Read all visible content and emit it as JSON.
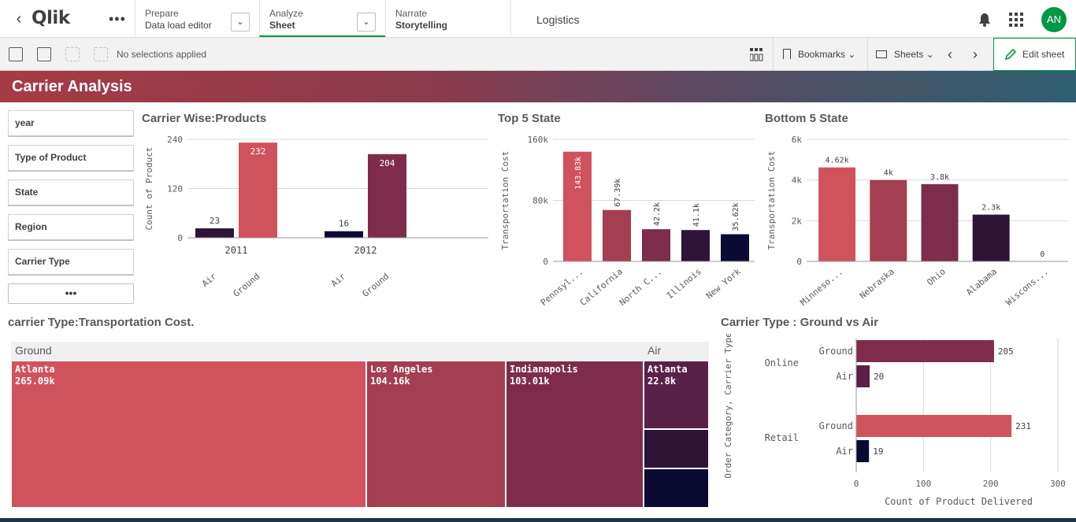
{
  "nav": {
    "prepare": {
      "sub": "Prepare",
      "main": "Data load editor"
    },
    "analyze": {
      "sub": "Analyze",
      "main": "Sheet"
    },
    "narrate": {
      "sub": "Narrate",
      "main": "Storytelling"
    },
    "app_title": "Logistics",
    "avatar": "AN",
    "logo": "Qlik"
  },
  "toolbar": {
    "no_selections": "No selections applied",
    "bookmarks": "Bookmarks",
    "sheets": "Sheets",
    "edit_sheet": "Edit sheet"
  },
  "sheet_title": "Carrier Analysis",
  "filters": [
    "year",
    "Type of Product",
    "State",
    "Region",
    "Carrier Type"
  ],
  "filter_more": "•••",
  "colors": {
    "c1": "#d0525d",
    "c2": "#a43e52",
    "c3": "#7d2c4c",
    "c4": "#5a2148",
    "c5": "#2e1437",
    "c6": "#0a0a33",
    "accent": "#009845"
  },
  "panels": {
    "carrier_products": "Carrier Wise:Products",
    "top5": "Top 5 State",
    "bottom5": "Bottom 5 State",
    "treemap": "carrier Type:Transportation Cost.",
    "ground_vs_air": "Carrier Type : Ground vs Air"
  },
  "chart_data": [
    {
      "type": "bar",
      "title": "Carrier Wise:Products",
      "ylabel": "Count of Product",
      "ylim": [
        0,
        240
      ],
      "yticks": [
        "0",
        "120",
        "240"
      ],
      "categories": [
        "2011",
        "2012"
      ],
      "series": [
        {
          "name": "Air",
          "values": [
            23,
            16
          ]
        },
        {
          "name": "Ground",
          "values": [
            232,
            204
          ]
        }
      ]
    },
    {
      "type": "bar",
      "title": "Top 5 State",
      "ylabel": "Transportation Cost",
      "ylim": [
        0,
        160000
      ],
      "yticks": [
        "0",
        "80k",
        "160k"
      ],
      "categories": [
        "Pennsyl...",
        "California",
        "North C...",
        "Illinois",
        "New York"
      ],
      "values": [
        143830,
        67390,
        42200,
        41100,
        35620
      ],
      "labels": [
        "143.83k",
        "67.39k",
        "42.2k",
        "41.1k",
        "35.62k"
      ]
    },
    {
      "type": "bar",
      "title": "Bottom 5 State",
      "ylabel": "Transportation Cost",
      "ylim": [
        0,
        6000
      ],
      "yticks": [
        "0",
        "2k",
        "4k",
        "6k"
      ],
      "categories": [
        "Minneso...",
        "Nebraska",
        "Ohio",
        "Alabama",
        "Wiscons..."
      ],
      "values": [
        4620,
        4000,
        3800,
        2300,
        0
      ],
      "labels": [
        "4.62k",
        "4k",
        "3.8k",
        "2.3k",
        "0"
      ]
    },
    {
      "type": "treemap",
      "title": "carrier Type:Transportation Cost.",
      "groups": [
        {
          "name": "Ground",
          "items": [
            {
              "label": "Atlanta",
              "value": "265.09k"
            },
            {
              "label": "Los Angeles",
              "value": "104.16k"
            },
            {
              "label": "Indianapolis",
              "value": "103.01k"
            }
          ]
        },
        {
          "name": "Air",
          "items": [
            {
              "label": "Atlanta",
              "value": "22.8k"
            },
            {
              "label": "",
              "value": ""
            },
            {
              "label": "",
              "value": ""
            }
          ]
        }
      ]
    },
    {
      "type": "bar",
      "orientation": "horizontal",
      "title": "Carrier Type : Ground vs Air",
      "xlabel": "Count of Product Delivered",
      "ylabel": "Order Category, Carrier Type",
      "xlim": [
        0,
        300
      ],
      "xticks": [
        "0",
        "100",
        "200",
        "300"
      ],
      "groups": [
        {
          "name": "Online",
          "bars": [
            {
              "name": "Ground",
              "value": 205
            },
            {
              "name": "Air",
              "value": 20
            }
          ]
        },
        {
          "name": "Retail",
          "bars": [
            {
              "name": "Ground",
              "value": 231
            },
            {
              "name": "Air",
              "value": 19
            }
          ]
        }
      ]
    }
  ]
}
